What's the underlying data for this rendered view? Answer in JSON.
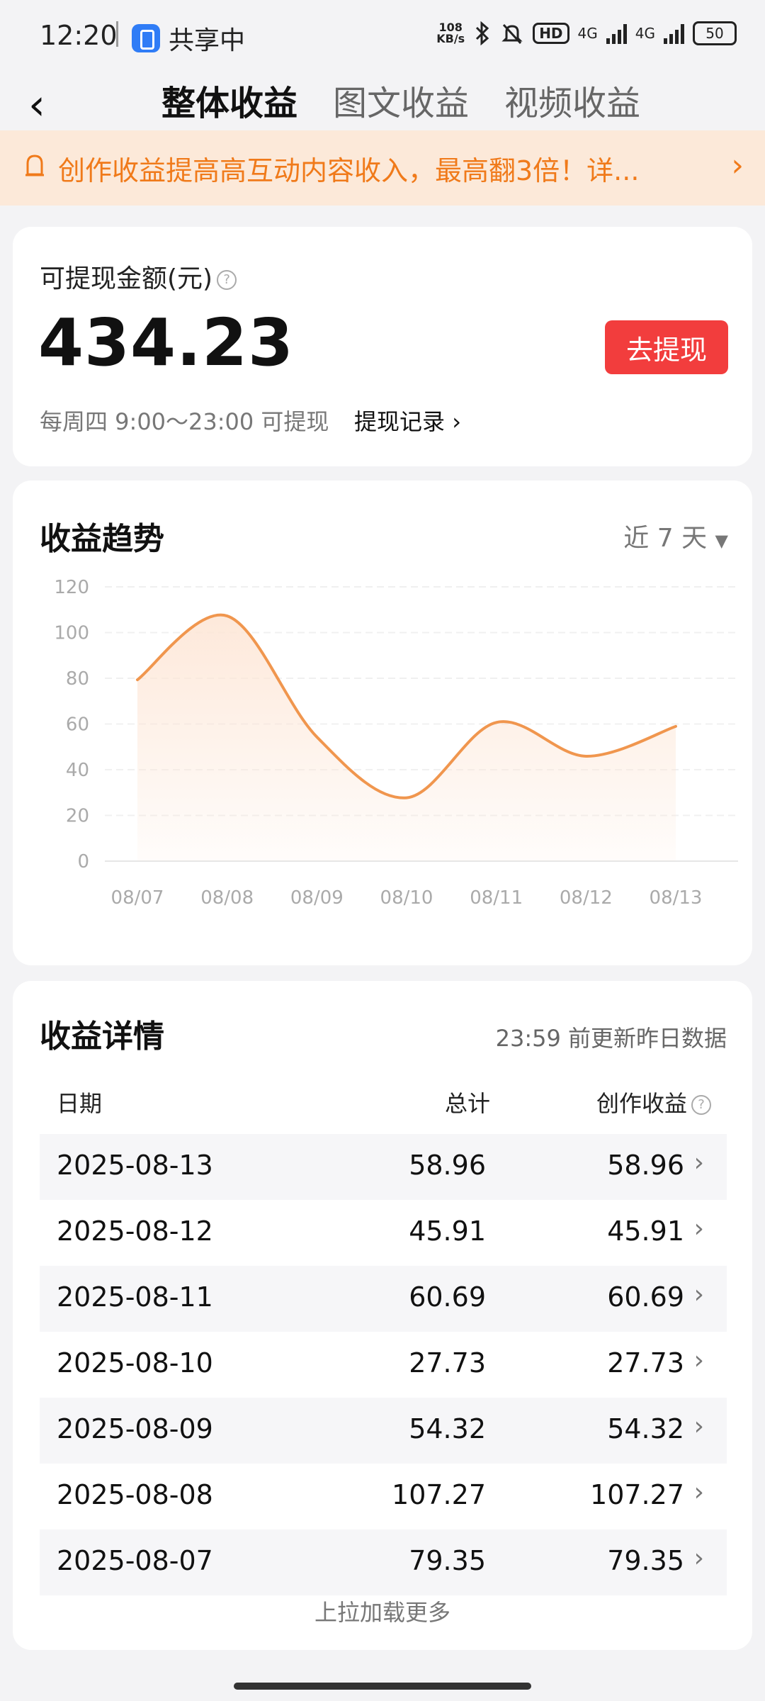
{
  "status_bar": {
    "time": "12:20",
    "share_label": "共享中",
    "net_speed_value": "108",
    "net_speed_unit": "KB/s",
    "hd_label": "HD",
    "network_1": "4G",
    "network_2": "4G",
    "battery": "50"
  },
  "header": {
    "tabs": [
      {
        "label": "整体收益",
        "active": true
      },
      {
        "label": "图文收益",
        "active": false
      },
      {
        "label": "视频收益",
        "active": false
      }
    ]
  },
  "banner": {
    "text": "创作收益提高高互动内容收入，最高翻3倍！详..."
  },
  "balance": {
    "label": "可提现金额(元)",
    "amount": "434.23",
    "withdraw_button": "去提现",
    "note": "每周四 9:00～23:00 可提现",
    "record_link": "提现记录"
  },
  "trend": {
    "title": "收益趋势",
    "range": "近 7 天"
  },
  "chart_data": {
    "type": "area",
    "categories": [
      "08/07",
      "08/08",
      "08/09",
      "08/10",
      "08/11",
      "08/12",
      "08/13"
    ],
    "values": [
      79.35,
      107.27,
      54.32,
      27.73,
      60.69,
      45.91,
      58.96
    ],
    "ylim": [
      0,
      120
    ],
    "yticks": [
      0,
      20,
      40,
      60,
      80,
      100,
      120
    ],
    "grid": true,
    "color": "#f0964e",
    "fill_color": "#fde6d6"
  },
  "details": {
    "title": "收益详情",
    "note": "23:59 前更新昨日数据",
    "columns": {
      "date": "日期",
      "total": "总计",
      "creation": "创作收益"
    },
    "rows": [
      {
        "date": "2025-08-13",
        "total": "58.96",
        "creation": "58.96"
      },
      {
        "date": "2025-08-12",
        "total": "45.91",
        "creation": "45.91"
      },
      {
        "date": "2025-08-11",
        "total": "60.69",
        "creation": "60.69"
      },
      {
        "date": "2025-08-10",
        "total": "27.73",
        "creation": "27.73"
      },
      {
        "date": "2025-08-09",
        "total": "54.32",
        "creation": "54.32"
      },
      {
        "date": "2025-08-08",
        "total": "107.27",
        "creation": "107.27"
      },
      {
        "date": "2025-08-07",
        "total": "79.35",
        "creation": "79.35"
      }
    ],
    "load_more": "上拉加载更多"
  }
}
